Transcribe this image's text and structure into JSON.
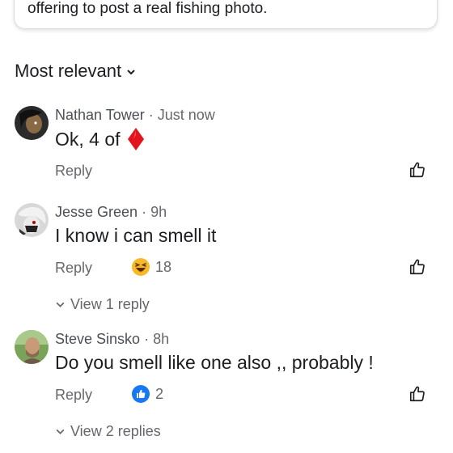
{
  "top_card": {
    "text": "offering to post a real fishing photo."
  },
  "sort": {
    "label": "Most relevant"
  },
  "comments": [
    {
      "author": "Nathan Tower",
      "time": "· Just now",
      "body": "Ok, 4 of",
      "reply_label": "Reply",
      "body_icon": "red-diamond-icon"
    },
    {
      "author": "Jesse Green",
      "time": "· 9h",
      "body": "I know i can smell it",
      "reply_label": "Reply",
      "reaction": {
        "icon": "laughing-emoji-icon",
        "count": "18"
      },
      "view_replies": "View 1 reply"
    },
    {
      "author": "Steve Sinsko",
      "time": "· 8h",
      "body": "Do you smell like one also ,, probably !",
      "reply_label": "Reply",
      "reaction": {
        "icon": "blue-like-icon",
        "count": "2"
      },
      "view_replies": "View 2 replies"
    }
  ],
  "colors": {
    "text_primary": "#1c1e21",
    "text_secondary": "#65676b",
    "like_blue": "#1877f2",
    "diamond_red": "#e4141e"
  }
}
